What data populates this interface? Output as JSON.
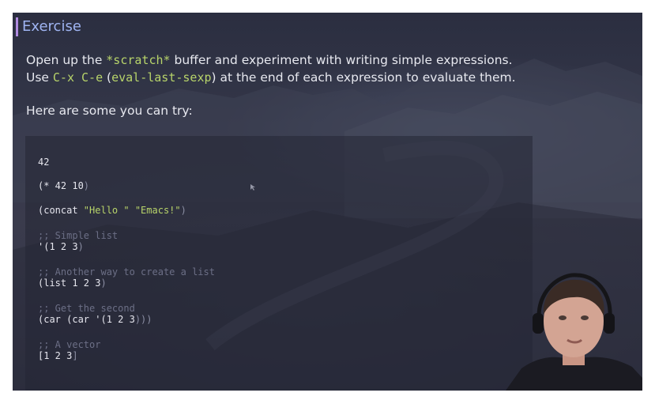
{
  "title": "Exercise",
  "intro": {
    "line1_pre": "Open up the ",
    "line1_code": "*scratch*",
    "line1_post": " buffer and experiment with writing simple expressions.",
    "line2_pre": "Use ",
    "line2_code1": "C-x C-e",
    "line2_mid": " (",
    "line2_code2": "eval-last-sexp",
    "line2_post": ") at the end of each expression to evaluate them.",
    "line3": "Here are some you can try:"
  },
  "code": {
    "l1": "42",
    "l2_open": "(* 42 10",
    "l2_close": ")",
    "l3_open": "(concat ",
    "l3_str1": "\"Hello \"",
    "l3_sp": " ",
    "l3_str2": "\"Emacs!\"",
    "l3_close": ")",
    "c1": ";; Simple list",
    "l4_open": "'(1 2 3",
    "l4_close": ")",
    "c2": ";; Another way to create a list",
    "l5_open": "(list 1 2 3",
    "l5_close": ")",
    "c3": ";; Get the second",
    "l6_open": "(car (car '(1 2 3",
    "l6_close": ")))",
    "c4": ";; A vector",
    "l7_open": "[1 2 3",
    "l7_close": "]"
  },
  "colors": {
    "title": "#9fb4f2",
    "accent_bar": "#b08be0",
    "code_green": "#b8d46a",
    "comment": "#6c6f86"
  }
}
